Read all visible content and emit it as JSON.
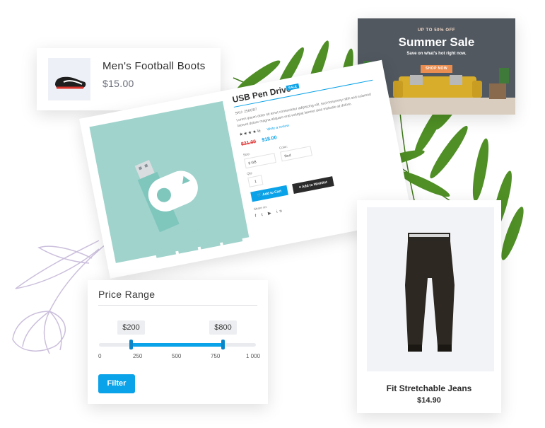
{
  "mini_product": {
    "name": "Men's Football Boots",
    "price": "$15.00"
  },
  "banner": {
    "kicker": "UP TO 50% OFF",
    "title": "Summer Sale",
    "subtitle": "Save on what's hot right now.",
    "button": "SHOP NOW"
  },
  "product_detail": {
    "title": "USB Pen Drive",
    "badge": "SALE",
    "sku": "SKU: 256GB7",
    "description": "Lorem ipsum dolor sit amet consectetur adipiscing elit, sed nonummy nibh sed euismod laoreet dolore magna aliquam erat volutpat laoreet duis molestie at dolore.",
    "rating_stars": "★★★★½",
    "write_review": "Write a review",
    "old_price": "$21.00",
    "new_price": "$18.00",
    "size_label": "Size:",
    "size_value": "8 GB",
    "color_label": "Color:",
    "color_value": "Red",
    "qty_label": "Qty:",
    "qty_value": "1",
    "add_to_cart": "Add to Cart",
    "add_to_wishlist": "Add to Wishlist",
    "share_label": "Share on:",
    "social_icons": "f t ▶ in"
  },
  "jeans_card": {
    "name": "Fit Stretchable Jeans",
    "price": "$14.90"
  },
  "price_range": {
    "title": "Price Range",
    "min_label": "$200",
    "max_label": "$800",
    "ticks": [
      "0",
      "250",
      "500",
      "750",
      "1 000"
    ],
    "min_value": 200,
    "max_value": 800,
    "scale_max": 1000,
    "button": "Filter",
    "accent_color": "#0aa2e8"
  }
}
